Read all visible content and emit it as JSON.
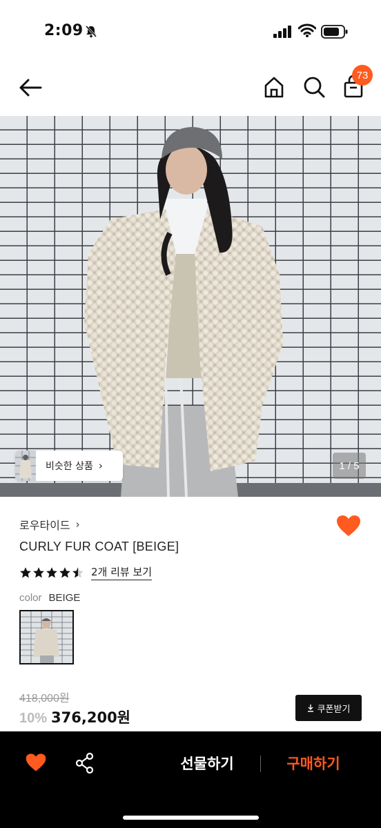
{
  "status_bar": {
    "time": "2:09"
  },
  "header": {
    "cart_count": "73"
  },
  "hero": {
    "similar_label": "비슷한 상품",
    "page_indicator": "1 / 5"
  },
  "product": {
    "brand": "로우타이드",
    "title": "CURLY FUR COAT [BEIGE]",
    "rating": 4.5,
    "review_link": "2개 리뷰 보기",
    "color_label": "color",
    "color_value": "BEIGE",
    "original_price": "418,000원",
    "discount": "10%",
    "sale_price": "376,200원",
    "coupon_label": "쿠폰받기"
  },
  "bottom_bar": {
    "gift_label": "선물하기",
    "buy_label": "구매하기"
  },
  "colors": {
    "accent": "#ff5a1f",
    "black": "#000000"
  }
}
